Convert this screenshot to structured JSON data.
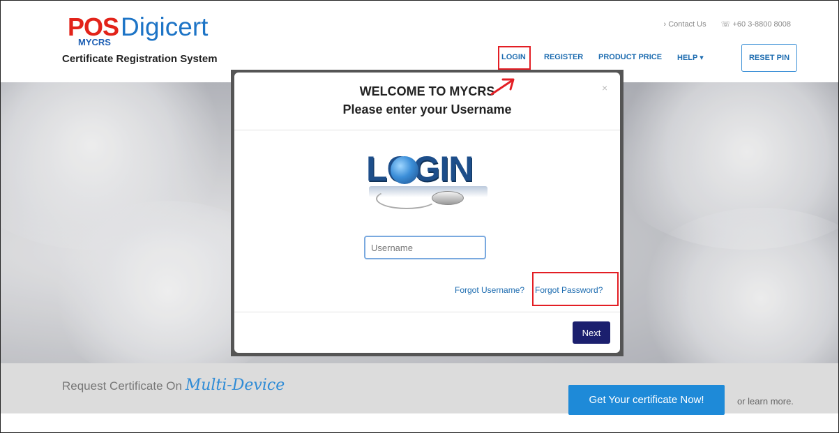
{
  "header": {
    "logo_pos": "POS",
    "logo_digicert": "Digicert",
    "logo_mycrs": "MYCRS",
    "logo_subtitle": "Certificate Registration System",
    "contact": "› Contact Us",
    "phone": "☏ +60 3-8800 8008",
    "nav": {
      "login": "LOGIN",
      "register": "REGISTER",
      "product_price": "PRODUCT PRICE",
      "help": "HELP ▾"
    },
    "reset_pin": "RESET PIN"
  },
  "modal": {
    "title_line1": "WELCOME TO MYCRS",
    "title_line2": "Please enter your Username",
    "close": "×",
    "login_art_text": "LOGIN",
    "username_placeholder": "Username",
    "username_value": "",
    "forgot_username": "Forgot Username?",
    "forgot_password": "Forgot Password?",
    "next": "Next"
  },
  "band": {
    "text": "Request Certificate On",
    "script": "Multi-Device",
    "cta": "Get Your certificate Now!",
    "learn_more": "or learn more."
  },
  "colors": {
    "brand_red": "#e2231a",
    "brand_blue": "#1d74c6",
    "link": "#1d6cb0",
    "next_button": "#1b1f6e",
    "cta": "#1e8ad8",
    "highlight": "#e31e24"
  }
}
